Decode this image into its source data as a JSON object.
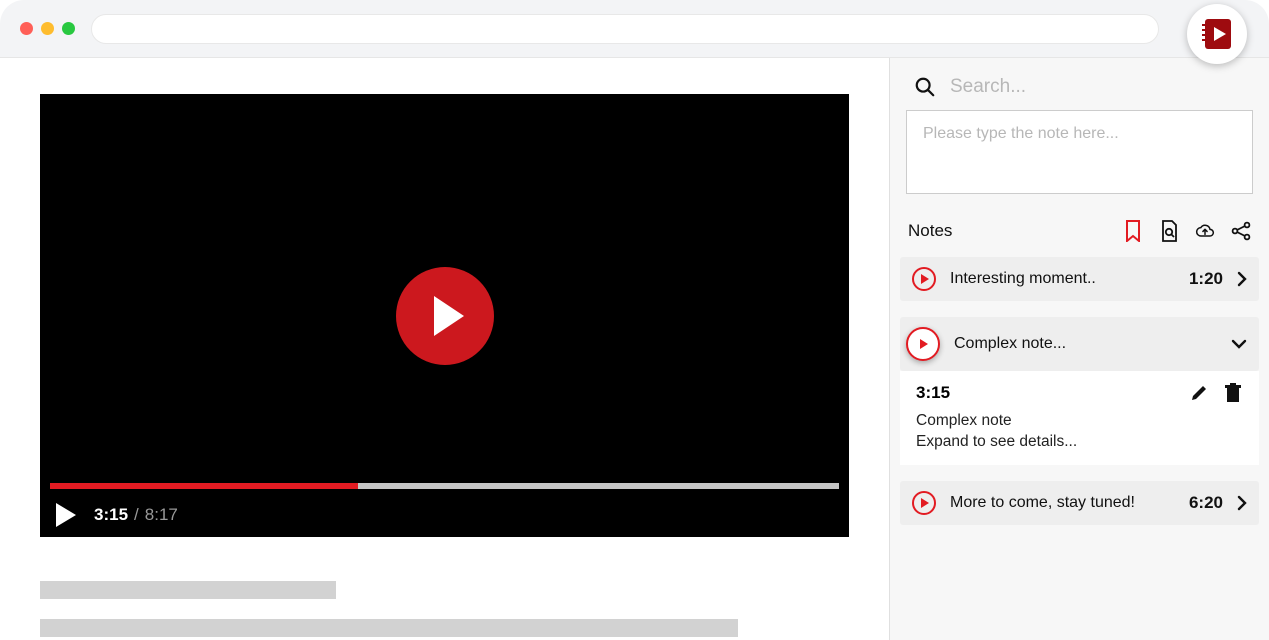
{
  "chrome": {
    "address": ""
  },
  "video": {
    "current_time": "3:15",
    "total_time": "8:17",
    "progress_pct": 39
  },
  "sidebar": {
    "search_placeholder": "Search...",
    "note_input_placeholder": "Please type the note here...",
    "title": "Notes",
    "notes": [
      {
        "label": "Interesting moment..",
        "time": "1:20"
      },
      {
        "label": "Complex note...",
        "time": ""
      },
      {
        "label": "More to come, stay tuned!",
        "time": "6:20"
      }
    ],
    "expanded": {
      "time": "3:15",
      "body": "Complex note\nExpand to see details..."
    }
  }
}
